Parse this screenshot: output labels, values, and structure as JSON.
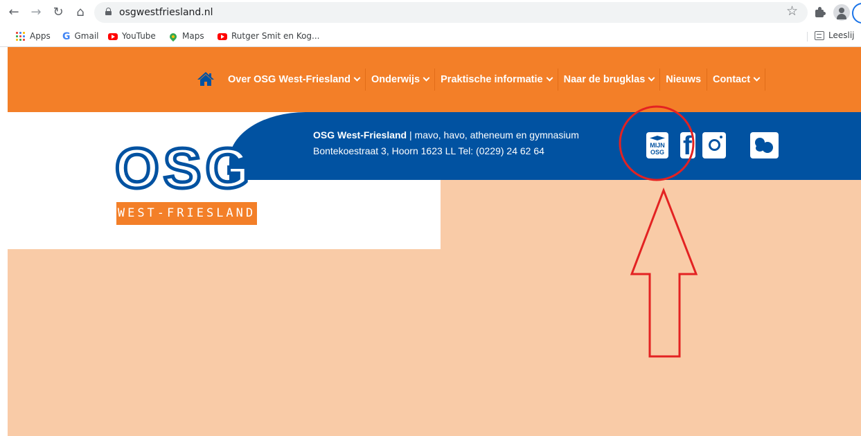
{
  "browser": {
    "url": "osgwestfriesland.nl",
    "bookmarks": [
      {
        "label": "Apps",
        "icon": "apps-grid-icon"
      },
      {
        "label": "Gmail",
        "icon": "google-icon"
      },
      {
        "label": "YouTube",
        "icon": "youtube-icon"
      },
      {
        "label": "Maps",
        "icon": "maps-pin-icon"
      },
      {
        "label": "Rutger Smit en Kog...",
        "icon": "youtube-icon"
      }
    ],
    "reading_list": "Leeslij"
  },
  "site": {
    "nav": {
      "items": [
        {
          "label": "Over OSG West-Friesland",
          "has_dropdown": true
        },
        {
          "label": "Onderwijs",
          "has_dropdown": true
        },
        {
          "label": "Praktische informatie",
          "has_dropdown": true
        },
        {
          "label": "Naar de brugklas",
          "has_dropdown": true
        },
        {
          "label": "Nieuws",
          "has_dropdown": false
        },
        {
          "label": "Contact",
          "has_dropdown": true
        }
      ]
    },
    "logo": {
      "letters": "OSG",
      "subtitle": "WEST-FRIESLAND"
    },
    "info": {
      "school_name": "OSG West-Friesland",
      "separator": " | ",
      "school_types": "mavo, havo, atheneum en gymnasium",
      "address": "Bontekoestraat 3, Hoorn 1623 LL Tel: (0229) 24 62 64"
    },
    "social": {
      "mijn_osg_line1": "MIJN",
      "mijn_osg_line2": "OSG",
      "facebook_glyph": "f"
    },
    "colors": {
      "orange": "#f37f28",
      "blue": "#0152a1",
      "peach": "#f9cba7",
      "annotation_red": "#e32222"
    }
  }
}
